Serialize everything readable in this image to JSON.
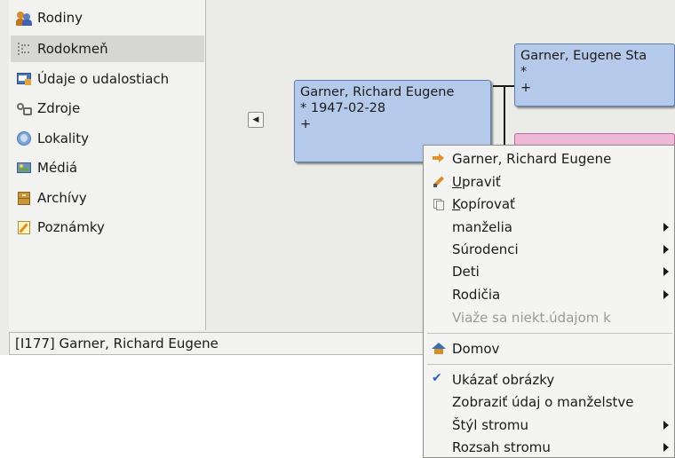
{
  "sidebar": {
    "items": [
      {
        "label": "Rodiny",
        "icon": "families-icon",
        "active": false
      },
      {
        "label": "Rodokmeň",
        "icon": "pedigree-icon",
        "active": true
      },
      {
        "label": "Údaje o udalostiach",
        "icon": "events-icon",
        "active": false
      },
      {
        "label": "Zdroje",
        "icon": "sources-icon",
        "active": false
      },
      {
        "label": "Lokality",
        "icon": "places-icon",
        "active": false
      },
      {
        "label": "Médiá",
        "icon": "media-icon",
        "active": false
      },
      {
        "label": "Archívy",
        "icon": "repositories-icon",
        "active": false
      },
      {
        "label": "Poznámky",
        "icon": "notes-icon",
        "active": false
      }
    ]
  },
  "statusbar": {
    "text": "[I177] Garner, Richard Eugene"
  },
  "pedigree": {
    "nav_button_glyph": "◀",
    "active_person": {
      "name": "Garner, Richard Eugene",
      "birth": "* 1947-02-28",
      "death": "+"
    },
    "father": {
      "name": "Garner, Eugene Sta",
      "birth": "*",
      "death": "+"
    }
  },
  "context_menu": {
    "person": {
      "label": "Garner, Richard Eugene",
      "icon": "go-to-person-icon"
    },
    "edit": {
      "mnemonic": "U",
      "rest": "praviť",
      "icon": "edit-icon"
    },
    "copy": {
      "mnemonic": "K",
      "rest": "opírovať",
      "icon": "copy-icon"
    },
    "spouses": "manželia",
    "siblings": "Súrodenci",
    "children": "Deti",
    "parents": "Rodičia",
    "related": "Viaže sa niekt.údajom k",
    "home": {
      "label": "Domov",
      "icon": "home-icon"
    },
    "show_images": {
      "label": "Ukázať obrázky",
      "checked": true,
      "icon": "check-icon"
    },
    "show_marriage": "Zobraziť údaj o manželstve",
    "tree_style": "Štýl stromu",
    "tree_size": "Rozsah stromu"
  },
  "colors": {
    "male_box": "#b5c9ea",
    "female_box": "#f0b8d8",
    "sidebar_active": "#d6d6d2"
  }
}
